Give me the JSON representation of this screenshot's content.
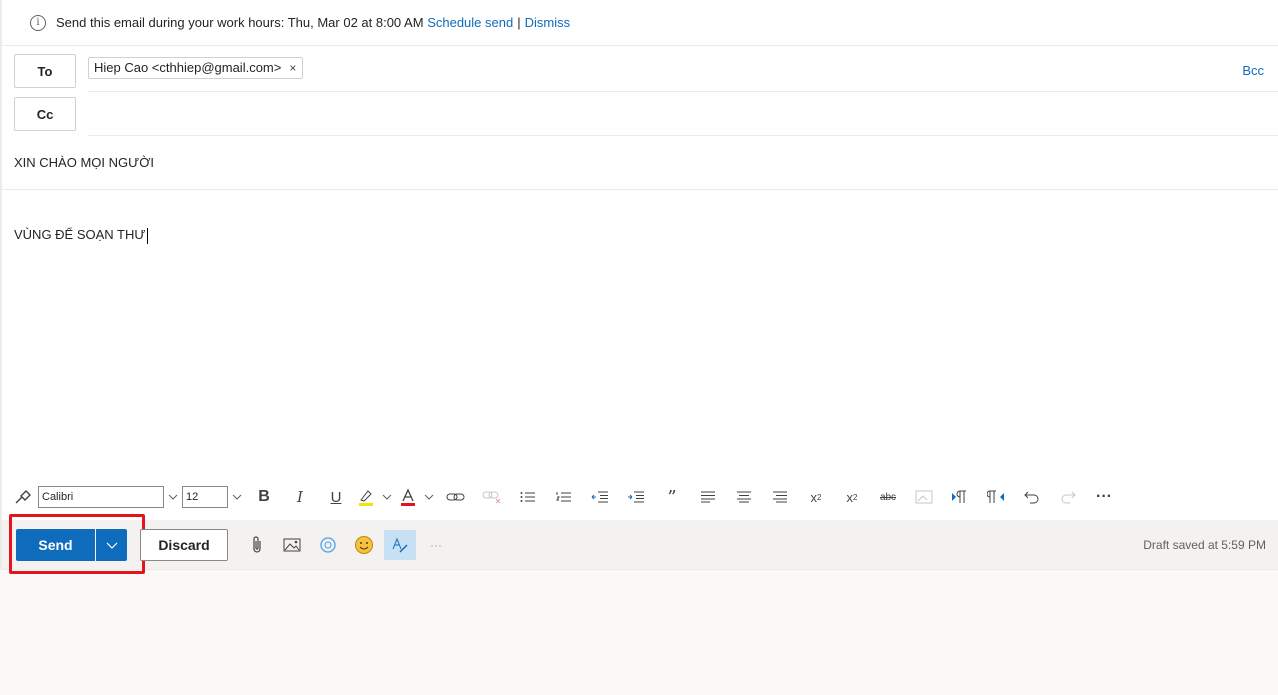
{
  "info_bar": {
    "message": "Send this email during your work hours: Thu, Mar 02 at 8:00 AM",
    "schedule_link": "Schedule send",
    "separator": "|",
    "dismiss_link": "Dismiss",
    "icon": "info-icon"
  },
  "recipients": {
    "to_label": "To",
    "cc_label": "Cc",
    "bcc_label": "Bcc",
    "to_chips": [
      {
        "label": "Hiep Cao <cthhiep@gmail.com>",
        "remove": "×"
      }
    ]
  },
  "subject": "XIN CHÀO MỌI NGƯỜI",
  "body": "VÙNG ĐỂ SOẠN THƯ",
  "format_bar": {
    "font_name": "Calibri",
    "font_size": "12",
    "icons": [
      "format-painter-icon",
      "bold-icon",
      "italic-icon",
      "underline-icon",
      "highlight-icon",
      "font-color-icon",
      "link-icon",
      "remove-link-icon",
      "bullets-icon",
      "numbering-icon",
      "decrease-indent-icon",
      "increase-indent-icon",
      "quote-icon",
      "align-left-icon",
      "align-center-icon",
      "align-right-icon",
      "superscript-icon",
      "subscript-icon",
      "strikethrough-icon",
      "image-icon",
      "ltr-icon",
      "rtl-icon",
      "undo-icon",
      "redo-icon",
      "more-icon"
    ]
  },
  "actions": {
    "send_label": "Send",
    "discard_label": "Discard",
    "status": "Draft saved at 5:59 PM",
    "accent": "#0f6cbd",
    "highlight_color": "#e4141d"
  }
}
